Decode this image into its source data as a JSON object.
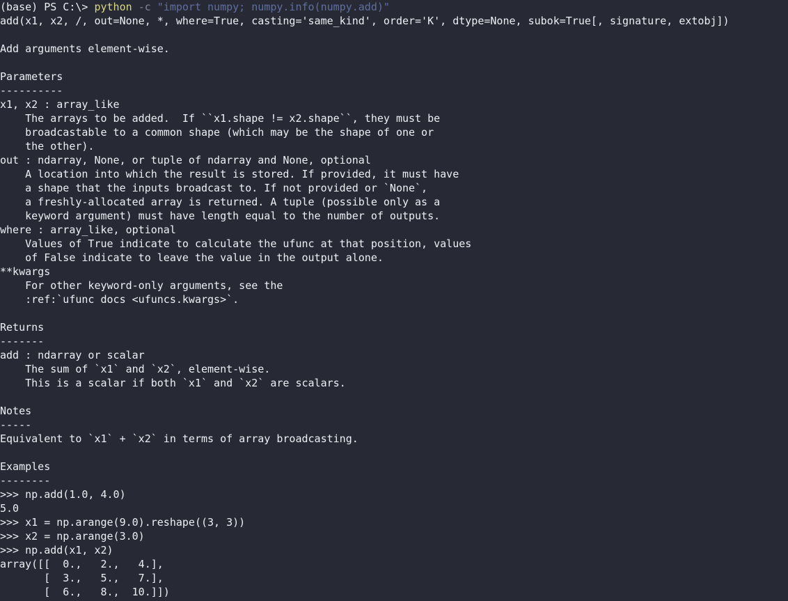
{
  "terminal": {
    "shell": "PowerShell",
    "colors": {
      "background": "#272a35",
      "foreground": "#eceff4",
      "command": "#d8d884",
      "parameter": "#7f8699",
      "string": "#5f6f9e"
    },
    "prompt": {
      "env": "(base)",
      "shell_label": "PS",
      "path": "C:\\>",
      "full": "(base) PS C:\\> ",
      "command": "python",
      "flag": "-c",
      "argument": "\"import numpy; numpy.info(numpy.add)\""
    },
    "output_lines": [
      "add(x1, x2, /, out=None, *, where=True, casting='same_kind', order='K', dtype=None, subok=True[, signature, extobj])",
      "",
      "Add arguments element-wise.",
      "",
      "Parameters",
      "----------",
      "x1, x2 : array_like",
      "    The arrays to be added.  If ``x1.shape != x2.shape``, they must be",
      "    broadcastable to a common shape (which may be the shape of one or",
      "    the other).",
      "out : ndarray, None, or tuple of ndarray and None, optional",
      "    A location into which the result is stored. If provided, it must have",
      "    a shape that the inputs broadcast to. If not provided or `None`,",
      "    a freshly-allocated array is returned. A tuple (possible only as a",
      "    keyword argument) must have length equal to the number of outputs.",
      "where : array_like, optional",
      "    Values of True indicate to calculate the ufunc at that position, values",
      "    of False indicate to leave the value in the output alone.",
      "**kwargs",
      "    For other keyword-only arguments, see the",
      "    :ref:`ufunc docs <ufuncs.kwargs>`.",
      "",
      "Returns",
      "-------",
      "add : ndarray or scalar",
      "    The sum of `x1` and `x2`, element-wise.",
      "    This is a scalar if both `x1` and `x2` are scalars.",
      "",
      "Notes",
      "-----",
      "Equivalent to `x1` + `x2` in terms of array broadcasting.",
      "",
      "Examples",
      "--------",
      ">>> np.add(1.0, 4.0)",
      "5.0",
      ">>> x1 = np.arange(9.0).reshape((3, 3))",
      ">>> x2 = np.arange(3.0)",
      ">>> np.add(x1, x2)",
      "array([[  0.,   2.,   4.],",
      "       [  3.,   5.,   7.],",
      "       [  6.,   8.,  10.]])"
    ]
  }
}
